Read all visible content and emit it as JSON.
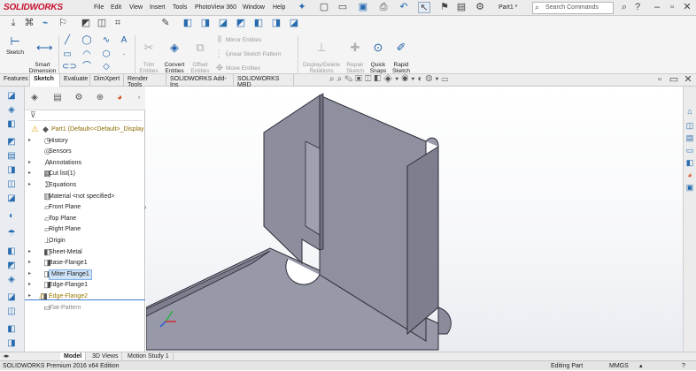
{
  "app": {
    "logo": "SOLIDWORKS",
    "document_name": "Part1 *"
  },
  "menu": [
    "File",
    "Edit",
    "View",
    "Insert",
    "Tools",
    "PhotoView 360",
    "Window",
    "Help"
  ],
  "search": {
    "placeholder": "Search Commands"
  },
  "ribbon": {
    "sketch": "Sketch",
    "smart_dimension": "Smart\nDimension",
    "trim_entities": "Trim\nEntities",
    "convert_entities": "Convert\nEntities",
    "offset_entities": "Offset\nEntities",
    "mirror_entities": "Mirror Entities",
    "linear_pattern": "Linear Sketch Pattern",
    "move_entities": "Move Entities",
    "display_delete": "Display/Delete\nRelations",
    "repair_sketch": "Repair\nSketch",
    "quick_snaps": "Quick\nSnaps",
    "rapid_sketch": "Rapid\nSketch"
  },
  "tabs": [
    "Features",
    "Sketch",
    "Evaluate",
    "DimXpert",
    "Render Tools",
    "SOLIDWORKS Add-Ins",
    "SOLIDWORKS MBD"
  ],
  "active_tab": "Sketch",
  "feature_tree": [
    {
      "label": "Part1  (Default<<Default>_Display S",
      "icon": "part-icon",
      "warn": true
    },
    {
      "label": "History",
      "icon": "history-icon"
    },
    {
      "label": "Sensors",
      "icon": "sensor-icon"
    },
    {
      "label": "Annotations",
      "icon": "annotation-icon"
    },
    {
      "label": "Cut list(1)",
      "icon": "cutlist-icon"
    },
    {
      "label": "Equations",
      "icon": "equation-icon"
    },
    {
      "label": "Material <not specified>",
      "icon": "material-icon"
    },
    {
      "label": "Front Plane",
      "icon": "plane-icon"
    },
    {
      "label": "Top Plane",
      "icon": "plane-icon"
    },
    {
      "label": "Right Plane",
      "icon": "plane-icon"
    },
    {
      "label": "Origin",
      "icon": "origin-icon"
    },
    {
      "label": "Sheet-Metal",
      "icon": "sheetmetal-icon"
    },
    {
      "label": "Base-Flange1",
      "icon": "flange-icon"
    },
    {
      "label": "Miter Flange1",
      "icon": "flange-icon",
      "selected": true
    },
    {
      "label": "Edge-Flange1",
      "icon": "flange-icon"
    },
    {
      "label": "Edge-Flange2",
      "icon": "flange-icon",
      "warn": true
    },
    {
      "label": "Flat-Pattern",
      "icon": "flatpattern-icon",
      "dim": true
    }
  ],
  "bottom_tabs": [
    "Model",
    "3D Views",
    "Motion Study 1"
  ],
  "status": {
    "edition": "SOLIDWORKS Premium 2016 x64 Edition",
    "mode": "Editing Part",
    "units": "MMGS"
  },
  "colors": {
    "model_face": "#8a8c9b",
    "model_edge": "#2c2d38",
    "accent": "#c8102e",
    "selection": "#cfe3f8"
  }
}
